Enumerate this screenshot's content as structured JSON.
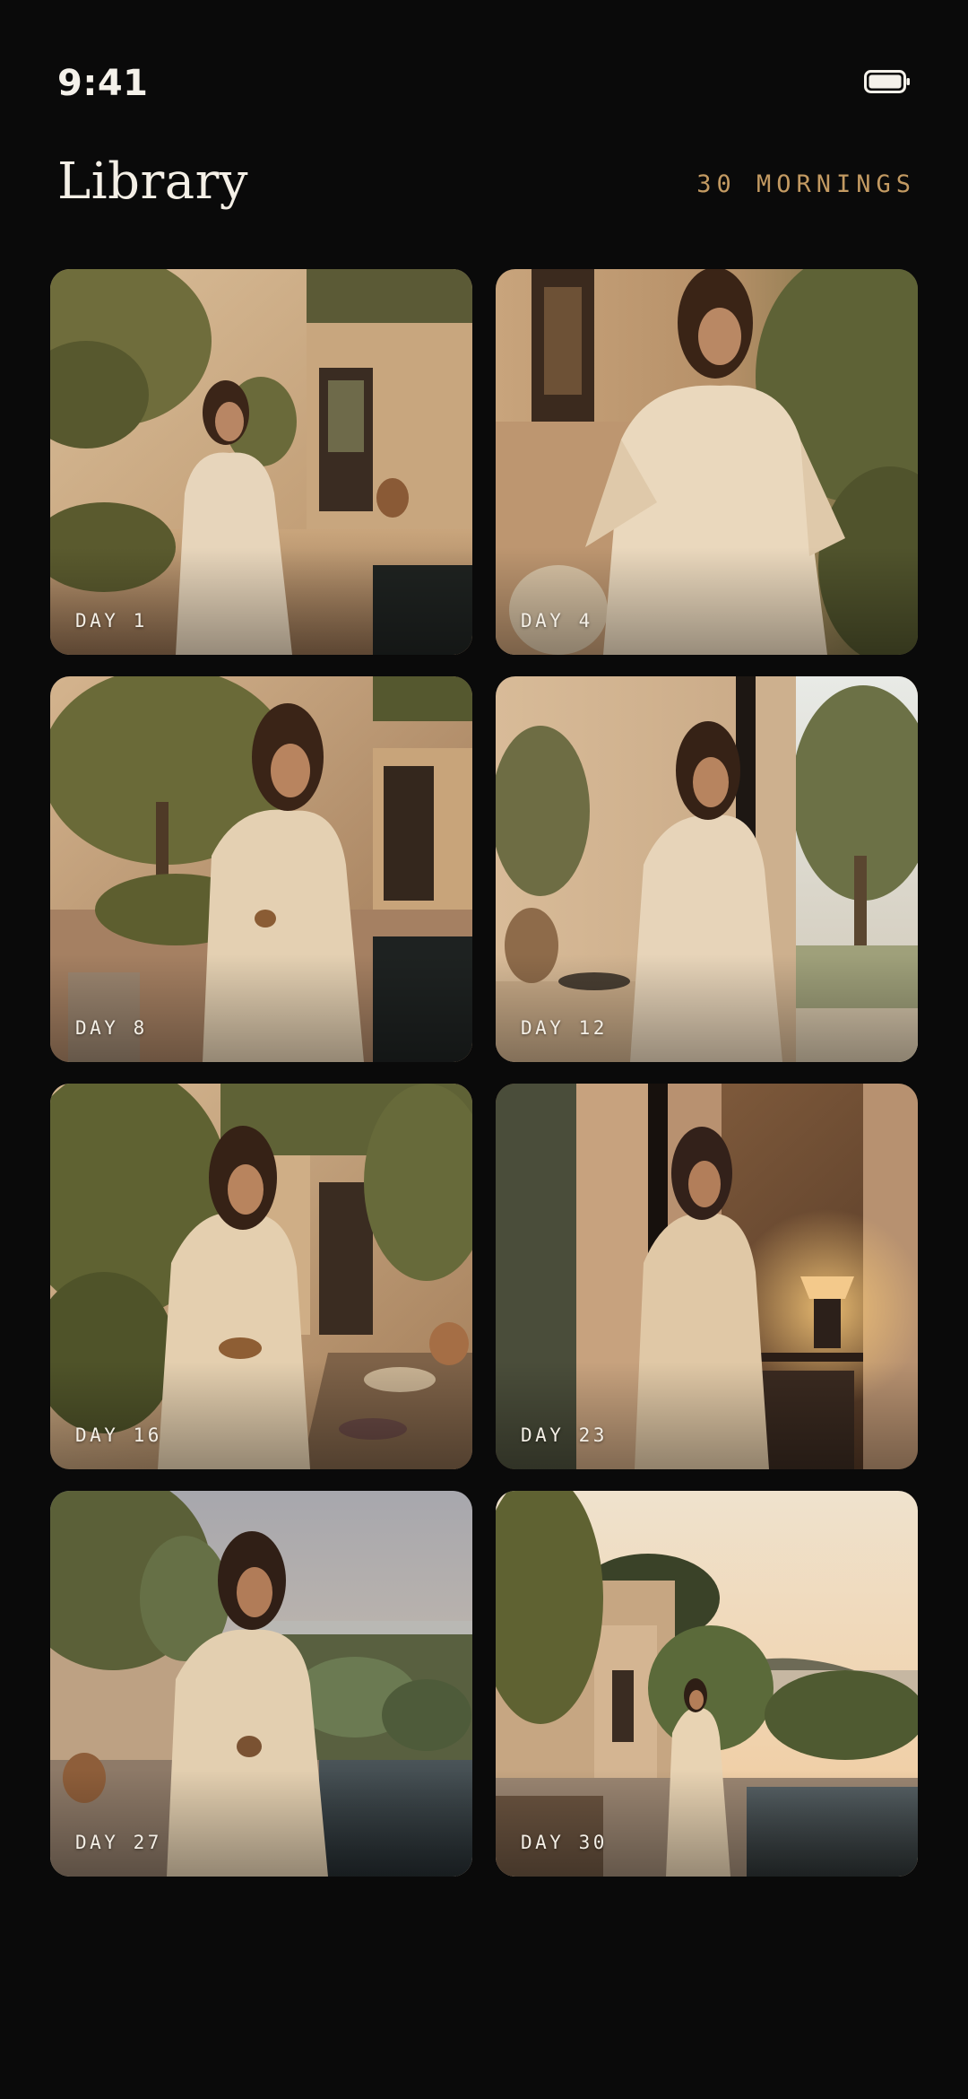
{
  "status_bar": {
    "time": "9:41",
    "battery_icon": "battery-full-icon"
  },
  "header": {
    "title": "Library",
    "count_label": "30 MORNINGS"
  },
  "entries": [
    {
      "label": "DAY 1",
      "scene": "courtyard-doorway-pool"
    },
    {
      "label": "DAY 4",
      "scene": "olive-tree-portrait"
    },
    {
      "label": "DAY 8",
      "scene": "olive-tree-pool-cup"
    },
    {
      "label": "DAY 12",
      "scene": "interior-doorway-olive"
    },
    {
      "label": "DAY 16",
      "scene": "outdoor-table-bowl"
    },
    {
      "label": "DAY 23",
      "scene": "lamp-lit-interior"
    },
    {
      "label": "DAY 27",
      "scene": "sea-view-cup"
    },
    {
      "label": "DAY 30",
      "scene": "sunset-pool-sea"
    }
  ],
  "colors": {
    "background": "#0a0a0a",
    "accent": "#c39a62",
    "text": "#f4efe6"
  }
}
